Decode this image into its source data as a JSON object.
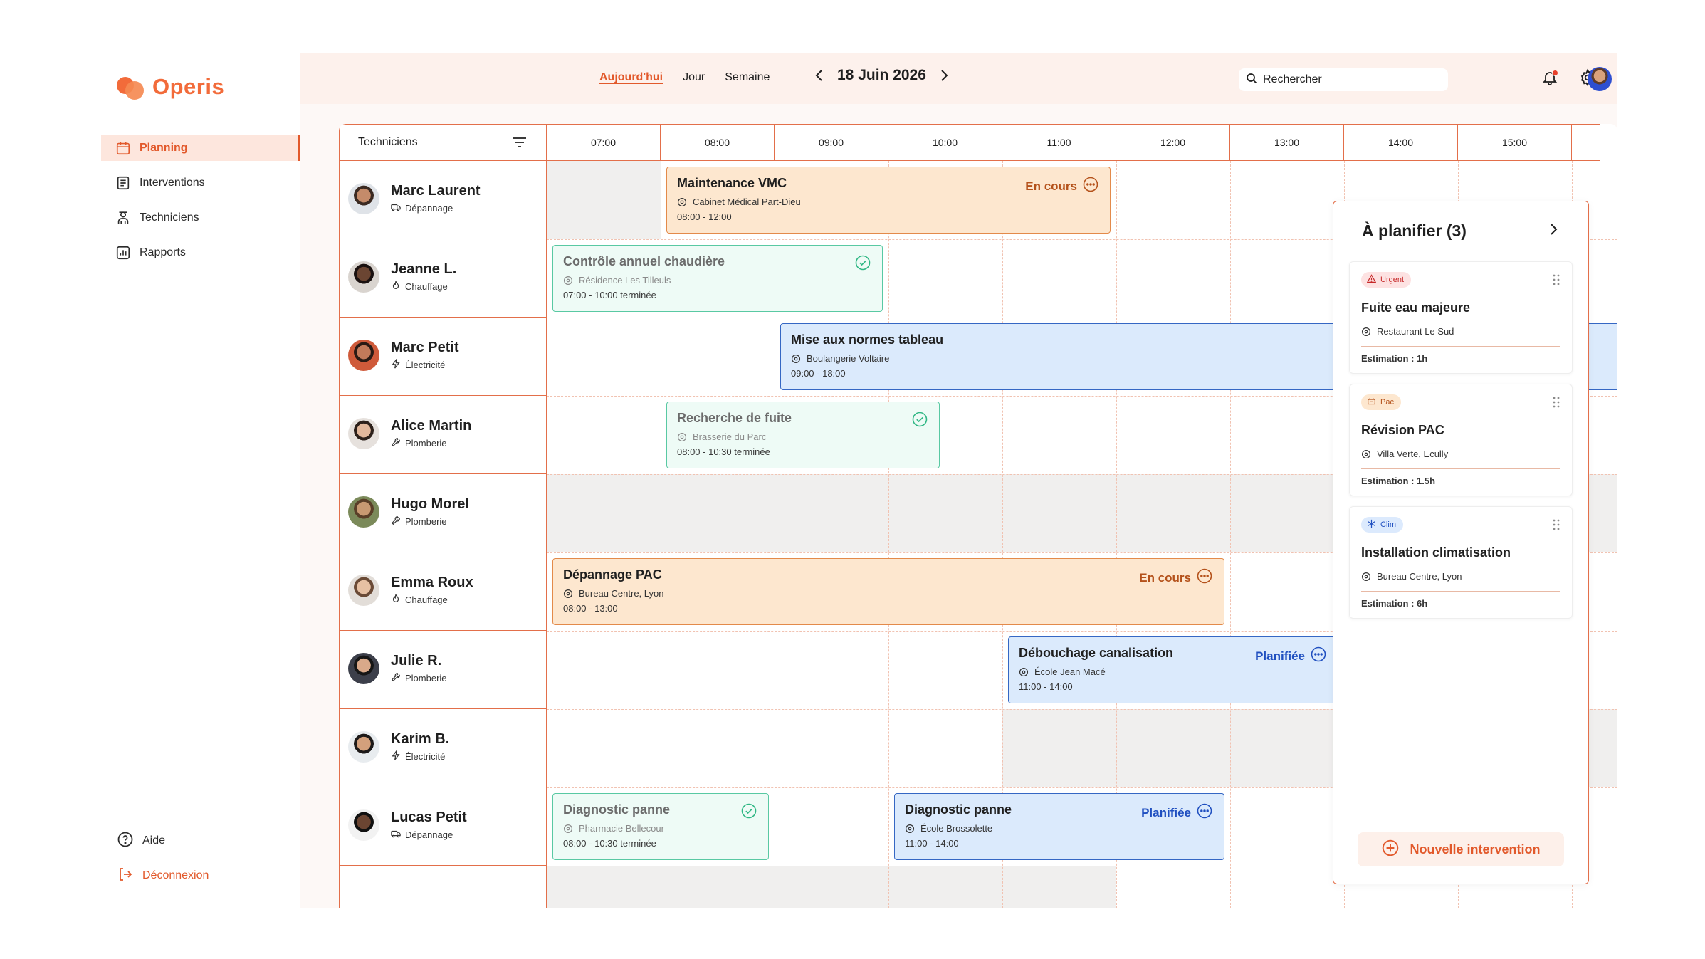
{
  "app": {
    "name": "Operis"
  },
  "sidebar": {
    "items": [
      {
        "label": "Planning",
        "icon": "calendar-icon",
        "active": true
      },
      {
        "label": "Interventions",
        "icon": "document-icon",
        "active": false
      },
      {
        "label": "Techniciens",
        "icon": "technician-icon",
        "active": false
      },
      {
        "label": "Rapports",
        "icon": "chart-icon",
        "active": false
      }
    ],
    "footer": [
      {
        "label": "Aide",
        "icon": "help-icon"
      },
      {
        "label": "Déconnexion",
        "icon": "logout-icon"
      }
    ]
  },
  "topbar": {
    "views": [
      "Aujourd'hui",
      "Jour",
      "Semaine"
    ],
    "active_view": "Aujourd'hui",
    "date": "18 Juin 2026",
    "search_placeholder": "Rechercher",
    "has_notification": true
  },
  "planner": {
    "techniciens_header": "Techniciens",
    "hours": [
      "07:00",
      "08:00",
      "09:00",
      "10:00",
      "11:00",
      "12:00",
      "13:00",
      "14:00",
      "15:00"
    ],
    "technicians": [
      {
        "name": "Marc Laurent",
        "specialty": "Dépannage",
        "specialty_icon": "van-icon"
      },
      {
        "name": "Jeanne L.",
        "specialty": "Chauffage",
        "specialty_icon": "flame-icon"
      },
      {
        "name": "Marc Petit",
        "specialty": "Électricité",
        "specialty_icon": "bolt-icon"
      },
      {
        "name": "Alice Martin",
        "specialty": "Plomberie",
        "specialty_icon": "wrench-icon"
      },
      {
        "name": "Hugo Morel",
        "specialty": "Plomberie",
        "specialty_icon": "wrench-icon"
      },
      {
        "name": "Emma Roux",
        "specialty": "Chauffage",
        "specialty_icon": "flame-icon"
      },
      {
        "name": "Julie R.",
        "specialty": "Plomberie",
        "specialty_icon": "wrench-icon"
      },
      {
        "name": "Karim B.",
        "specialty": "Électricité",
        "specialty_icon": "bolt-icon"
      },
      {
        "name": "Lucas Petit",
        "specialty": "Dépannage",
        "specialty_icon": "van-icon"
      }
    ],
    "interventions": [
      {
        "row": 0,
        "start": "08:00",
        "end": "12:00",
        "title": "Maintenance VMC",
        "location": "Cabinet Médical Part-Dieu",
        "time": "08:00 - 12:00",
        "status": "En cours",
        "kind": "orange"
      },
      {
        "row": 1,
        "start": "07:00",
        "end": "10:00",
        "title": "Contrôle annuel chaudière",
        "location": "Résidence Les Tilleuls",
        "time": "07:00 - 10:00 terminée",
        "status": "",
        "kind": "green"
      },
      {
        "row": 2,
        "start": "09:00",
        "end": "18:00",
        "title": "Mise aux normes tableau",
        "location": "Boulangerie Voltaire",
        "time": "09:00 - 18:00",
        "status": "",
        "kind": "blue"
      },
      {
        "row": 3,
        "start": "08:00",
        "end": "10:30",
        "title": "Recherche de fuite",
        "location": "Brasserie du Parc",
        "time": "08:00 - 10:30 terminée",
        "status": "",
        "kind": "green"
      },
      {
        "row": 5,
        "start": "07:00",
        "end": "13:00",
        "title": "Dépannage PAC",
        "location": "Bureau Centre, Lyon",
        "time": "08:00 - 13:00",
        "status": "En cours",
        "kind": "orange"
      },
      {
        "row": 6,
        "start": "11:00",
        "end": "14:00",
        "title": "Débouchage canalisation",
        "location": "École Jean Macé",
        "time": "11:00 - 14:00",
        "status": "Planifiée",
        "kind": "blue"
      },
      {
        "row": 8,
        "start": "07:00",
        "end": "09:00",
        "title": "Diagnostic panne",
        "location": "Pharmacie Bellecour",
        "time": "08:00 - 10:30 terminée",
        "status": "",
        "kind": "green"
      },
      {
        "row": 8,
        "start": "10:00",
        "end": "13:00",
        "title": "Diagnostic panne",
        "location": "École Brossolette",
        "time": "11:00 - 14:00",
        "status": "Planifiée",
        "kind": "blue"
      }
    ]
  },
  "panel": {
    "title": "À planifier (3)",
    "cards": [
      {
        "badge": "Urgent",
        "badge_kind": "urgent",
        "title": "Fuite eau majeure",
        "location": "Restaurant Le Sud",
        "estimate": "Estimation : 1h"
      },
      {
        "badge": "Pac",
        "badge_kind": "pac",
        "title": "Révision PAC",
        "location": "Villa Verte, Ecully",
        "estimate": "Estimation : 1.5h"
      },
      {
        "badge": "Clim",
        "badge_kind": "clim",
        "title": "Installation climatisation",
        "location": "Bureau Centre, Lyon",
        "estimate": "Estimation : 6h"
      }
    ],
    "new_button": "Nouvelle intervention"
  },
  "colors": {
    "accent": "#e2592b",
    "orange_card": "#fde7cf",
    "green_card": "#eefbf6",
    "blue_card": "#dbeafc"
  }
}
